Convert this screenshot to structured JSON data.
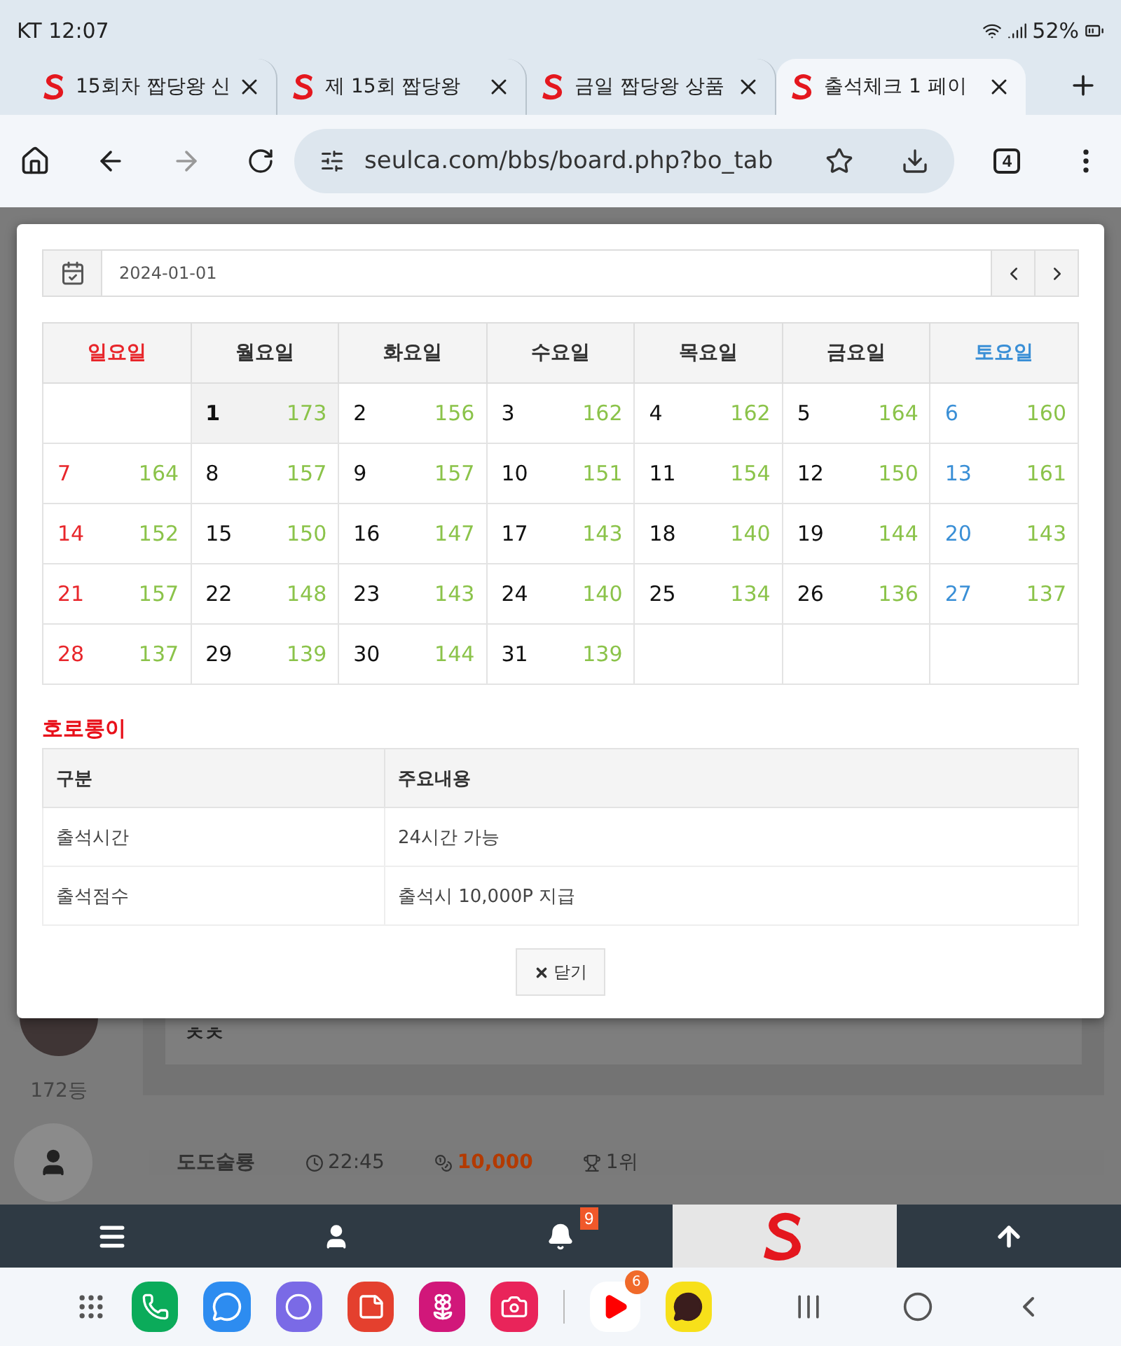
{
  "status_bar": {
    "carrier_time": "KT 12:07",
    "battery": "52%"
  },
  "tabs": [
    {
      "title": "15회차 짭당왕 신",
      "selected": false
    },
    {
      "title": "제 15회 짭당왕 ",
      "selected": false
    },
    {
      "title": "금일 짭당왕 상품",
      "selected": false
    },
    {
      "title": "출석체크 1 페이",
      "selected": true
    }
  ],
  "address_bar": {
    "url": "seulca.com/bbs/board.php?bo_tab",
    "tab_count": "4"
  },
  "background_page": {
    "rank": "172등",
    "comment": "ㅊㅊ",
    "author": "도도술룡",
    "time": "22:45",
    "points": "10,000",
    "place": "1위"
  },
  "modal": {
    "date": "2024-01-01",
    "weekdays": [
      {
        "label": "일요일",
        "color": "#e8262b"
      },
      {
        "label": "월요일",
        "color": "#333333"
      },
      {
        "label": "화요일",
        "color": "#333333"
      },
      {
        "label": "수요일",
        "color": "#333333"
      },
      {
        "label": "목요일",
        "color": "#333333"
      },
      {
        "label": "금요일",
        "color": "#333333"
      },
      {
        "label": "토요일",
        "color": "#3a8fd6"
      }
    ],
    "weeks": [
      [
        {
          "kind": "empty"
        },
        {
          "kind": "day",
          "day": "1",
          "count": "173",
          "today": true
        },
        {
          "kind": "day",
          "day": "2",
          "count": "156",
          "today": false
        },
        {
          "kind": "day",
          "day": "3",
          "count": "162",
          "today": false
        },
        {
          "kind": "day",
          "day": "4",
          "count": "162",
          "today": false
        },
        {
          "kind": "day",
          "day": "5",
          "count": "164",
          "today": false
        },
        {
          "kind": "day",
          "day": "6",
          "count": "160",
          "today": false
        }
      ],
      [
        {
          "kind": "day",
          "day": "7",
          "count": "164",
          "today": false
        },
        {
          "kind": "day",
          "day": "8",
          "count": "157",
          "today": false
        },
        {
          "kind": "day",
          "day": "9",
          "count": "157",
          "today": false
        },
        {
          "kind": "day",
          "day": "10",
          "count": "151",
          "today": false
        },
        {
          "kind": "day",
          "day": "11",
          "count": "154",
          "today": false
        },
        {
          "kind": "day",
          "day": "12",
          "count": "150",
          "today": false
        },
        {
          "kind": "day",
          "day": "13",
          "count": "161",
          "today": false
        }
      ],
      [
        {
          "kind": "day",
          "day": "14",
          "count": "152",
          "today": false
        },
        {
          "kind": "day",
          "day": "15",
          "count": "150",
          "today": false
        },
        {
          "kind": "day",
          "day": "16",
          "count": "147",
          "today": false
        },
        {
          "kind": "day",
          "day": "17",
          "count": "143",
          "today": false
        },
        {
          "kind": "day",
          "day": "18",
          "count": "140",
          "today": false
        },
        {
          "kind": "day",
          "day": "19",
          "count": "144",
          "today": false
        },
        {
          "kind": "day",
          "day": "20",
          "count": "143",
          "today": false
        }
      ],
      [
        {
          "kind": "day",
          "day": "21",
          "count": "157",
          "today": false
        },
        {
          "kind": "day",
          "day": "22",
          "count": "148",
          "today": false
        },
        {
          "kind": "day",
          "day": "23",
          "count": "143",
          "today": false
        },
        {
          "kind": "day",
          "day": "24",
          "count": "140",
          "today": false
        },
        {
          "kind": "day",
          "day": "25",
          "count": "134",
          "today": false
        },
        {
          "kind": "day",
          "day": "26",
          "count": "136",
          "today": false
        },
        {
          "kind": "day",
          "day": "27",
          "count": "137",
          "today": false
        }
      ],
      [
        {
          "kind": "day",
          "day": "28",
          "count": "137",
          "today": false
        },
        {
          "kind": "day",
          "day": "29",
          "count": "139",
          "today": false
        },
        {
          "kind": "day",
          "day": "30",
          "count": "144",
          "today": false
        },
        {
          "kind": "day",
          "day": "31",
          "count": "139",
          "today": false
        },
        {
          "kind": "empty"
        },
        {
          "kind": "empty"
        },
        {
          "kind": "empty"
        }
      ]
    ],
    "info_title": "호로롱이",
    "info_columns": [
      "구분",
      "주요내용"
    ],
    "info_rows": [
      [
        "출석시간",
        "24시간 가능"
      ],
      [
        "출석점수",
        "출석시 10,000P 지급"
      ]
    ],
    "close_button": "닫기"
  },
  "bottom_nav": {
    "notification_badge": "9"
  },
  "dock": {
    "youtube_badge": "6"
  }
}
